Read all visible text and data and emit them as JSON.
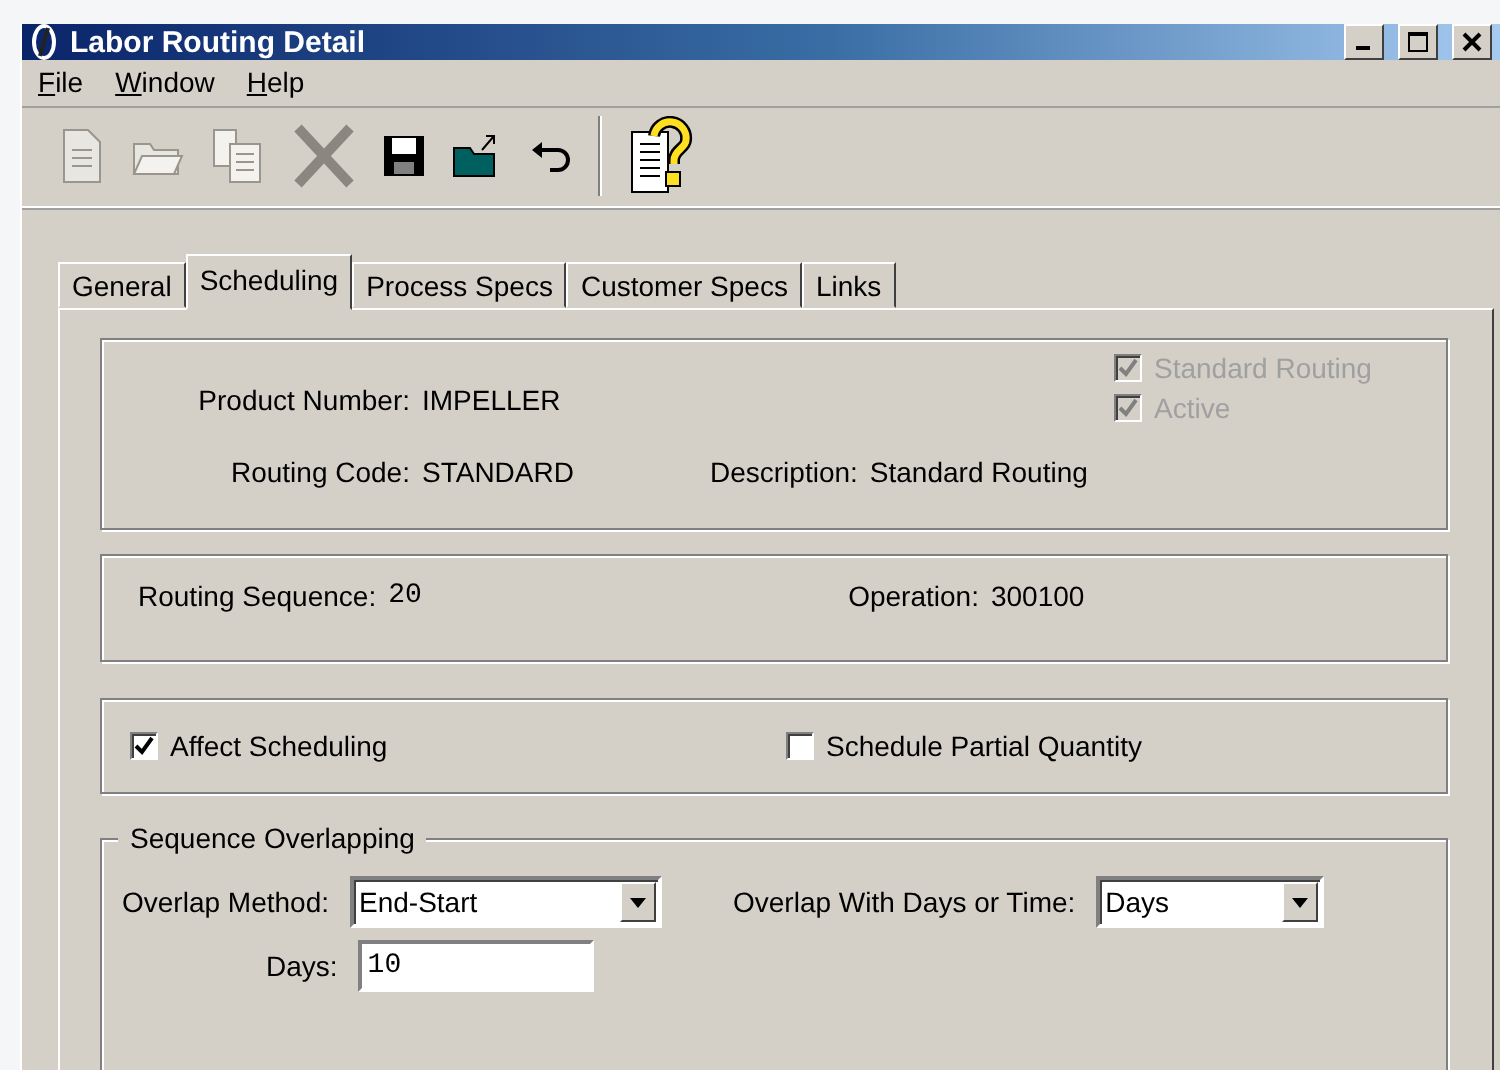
{
  "window": {
    "title": "Labor Routing Detail"
  },
  "menu": [
    {
      "label": "File"
    },
    {
      "label": "Window"
    },
    {
      "label": "Help"
    }
  ],
  "toolbar": [
    {
      "kind": "new",
      "disabled": true
    },
    {
      "kind": "open",
      "disabled": true
    },
    {
      "kind": "copy",
      "disabled": true
    },
    {
      "kind": "delete",
      "disabled": true
    },
    {
      "kind": "save",
      "disabled": false
    },
    {
      "kind": "open-folder",
      "disabled": false
    },
    {
      "kind": "undo",
      "disabled": false
    },
    {
      "kind": "separator"
    },
    {
      "kind": "help",
      "disabled": false
    }
  ],
  "tabs": [
    {
      "label": "General",
      "selected": false
    },
    {
      "label": "Scheduling",
      "selected": true
    },
    {
      "label": "Process Specs",
      "selected": false
    },
    {
      "label": "Customer Specs",
      "selected": false
    },
    {
      "label": "Links",
      "selected": false
    }
  ],
  "header": {
    "product_number": {
      "label": "Product Number:",
      "value": "IMPELLER"
    },
    "routing_code": {
      "label": "Routing Code:",
      "value": "STANDARD"
    },
    "description": {
      "label": "Description:",
      "value": "Standard Routing"
    },
    "checkboxes": [
      {
        "label": "Standard Routing",
        "checked": true,
        "disabled": true
      },
      {
        "label": "Active",
        "checked": true,
        "disabled": true
      }
    ]
  },
  "sequence": {
    "routing_sequence": {
      "label": "Routing Sequence:",
      "value": "20"
    },
    "operation": {
      "label": "Operation:",
      "value": "300100"
    }
  },
  "options": [
    {
      "label": "Affect Scheduling",
      "checked": true,
      "disabled": false
    },
    {
      "label": "Schedule Partial Quantity",
      "checked": false,
      "disabled": false
    }
  ],
  "overlapping": {
    "legend": "Sequence Overlapping",
    "overlap_method": {
      "label": "Overlap Method:",
      "value": "End-Start"
    },
    "overlap_with": {
      "label": "Overlap With Days or Time:",
      "value": "Days"
    },
    "days": {
      "label": "Days:",
      "value": "10"
    }
  }
}
